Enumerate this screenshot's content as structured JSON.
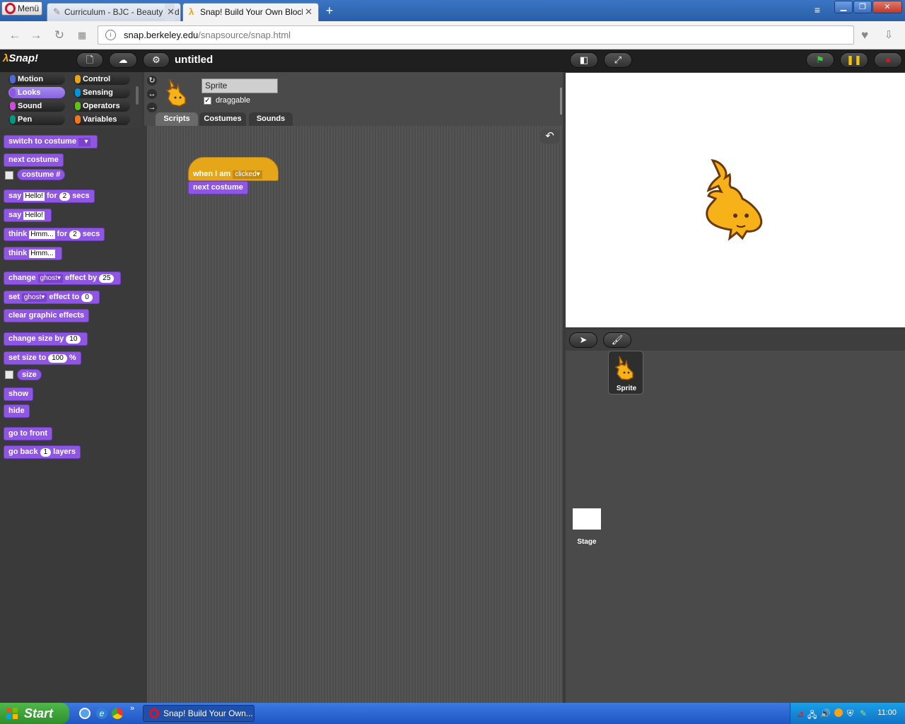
{
  "browser": {
    "menu_label": "Menü",
    "tabs": [
      {
        "label": "Curriculum - BJC - Beauty and",
        "active": false
      },
      {
        "label": "Snap! Build Your Own Blocks",
        "active": true
      }
    ],
    "new_tab": "+",
    "url_host": "snap.berkeley.edu",
    "url_path": "/snapsource/snap.html"
  },
  "snap": {
    "logo": "Snap!",
    "project_title": "untitled",
    "categories": [
      {
        "label": "Motion",
        "color": "#4a6cd4"
      },
      {
        "label": "Control",
        "color": "#e6a61a"
      },
      {
        "label": "Looks",
        "color": "#8f56e3"
      },
      {
        "label": "Sensing",
        "color": "#0494dc"
      },
      {
        "label": "Sound",
        "color": "#cf4ad9"
      },
      {
        "label": "Operators",
        "color": "#62c213"
      },
      {
        "label": "Pen",
        "color": "#009982"
      },
      {
        "label": "Variables",
        "color": "#f3761d"
      }
    ],
    "blocks": {
      "switch_to_costume": "switch to costume",
      "next_costume": "next costume",
      "costume_num": "costume #",
      "say": "say",
      "say_default": "Hello!",
      "for": "for",
      "secs": "secs",
      "secs_default": "2",
      "think": "think",
      "think_default": "Hmm...",
      "change": "change",
      "effect_ghost": "ghost",
      "effect_by": "effect by",
      "effect_by_default": "25",
      "set": "set",
      "effect_to": "effect to",
      "effect_to_default": "0",
      "clear_graphic_effects": "clear graphic effects",
      "change_size_by": "change size by",
      "change_size_default": "10",
      "set_size_to": "set size to",
      "set_size_default": "100",
      "percent": "%",
      "size": "size",
      "show": "show",
      "hide": "hide",
      "go_to_front": "go to front",
      "go_back": "go back",
      "go_back_default": "1",
      "layers": "layers"
    },
    "sprite": {
      "name": "Sprite",
      "draggable_label": "draggable",
      "draggable": true
    },
    "tabs": [
      "Scripts",
      "Costumes",
      "Sounds"
    ],
    "script": {
      "hat_text": "when I am",
      "hat_option": "clicked",
      "next_block": "next costume"
    },
    "corral": {
      "sprite_label": "Sprite",
      "stage_label": "Stage"
    }
  },
  "taskbar": {
    "start_label": "Start",
    "task_label": "Snap! Build Your Own...",
    "clock": "11:00"
  }
}
